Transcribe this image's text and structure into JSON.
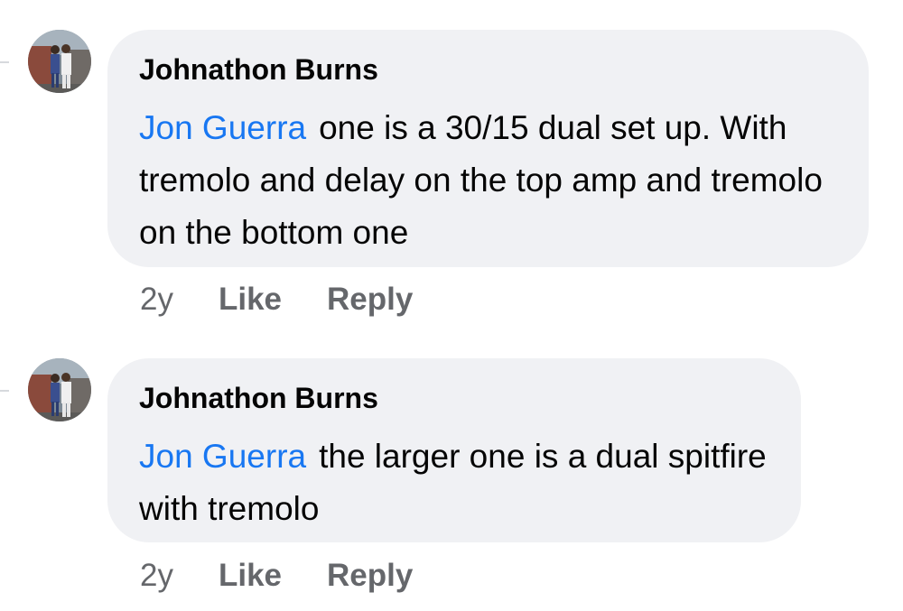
{
  "comments": [
    {
      "author": "Johnathon Burns",
      "mention": "Jon Guerra",
      "text": "one is a 30/15 dual set up. With tremolo and delay on the top amp and tremolo on the bottom one",
      "time": "2y",
      "like_label": "Like",
      "reply_label": "Reply"
    },
    {
      "author": "Johnathon Burns",
      "mention": "Jon Guerra",
      "text": "the larger one is a dual spitfire with tremolo",
      "time": "2y",
      "like_label": "Like",
      "reply_label": "Reply"
    }
  ],
  "colors": {
    "bubble": "#f0f1f4",
    "mention": "#1877f2",
    "meta": "#65676b",
    "text": "#050505"
  }
}
